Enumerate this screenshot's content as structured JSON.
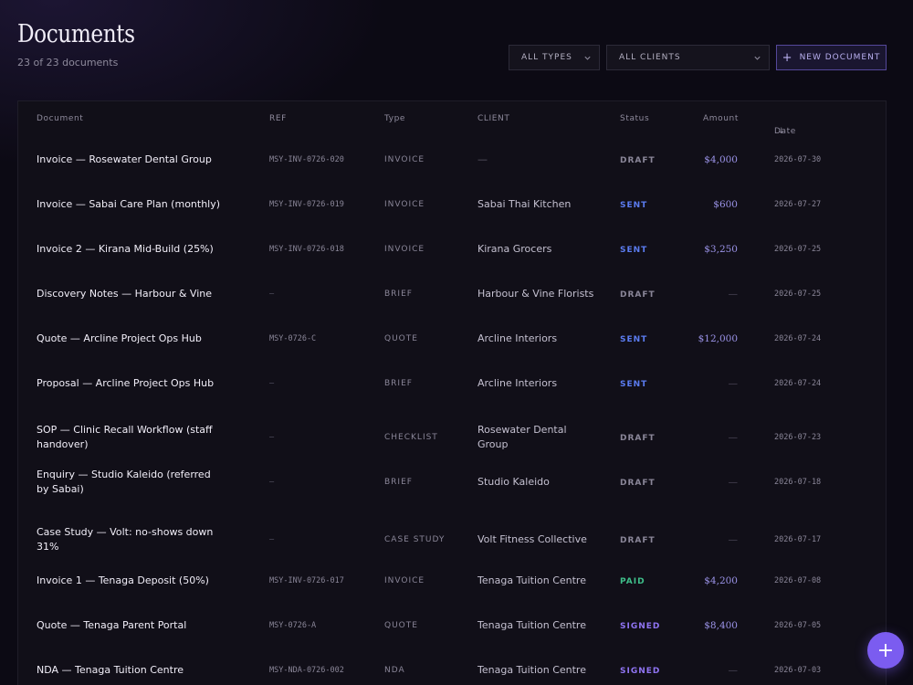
{
  "header": {
    "title": "Documents",
    "subtitle": "23 of 23 documents"
  },
  "toolbar": {
    "types_select": "ALL TYPES",
    "clients_select": "ALL CLIENTS",
    "new_document_label": "NEW DOCUMENT"
  },
  "columns": {
    "document": "Document",
    "ref": "REF",
    "type": "Type",
    "client": "CLIENT",
    "status": "Status",
    "amount": "Amount",
    "date": "Date",
    "date_sort": "↓"
  },
  "status_colors": {
    "DRAFT": "#8a8698",
    "SENT": "#5b7cf0",
    "PAID": "#3fbf8a",
    "SIGNED": "#8f74f2"
  },
  "rows": [
    {
      "name": "Invoice — Rosewater Dental Group",
      "ref": "MSY-INV-0726-020",
      "type": "INVOICE",
      "client": "—",
      "status": "DRAFT",
      "amount": "$4,000",
      "date": "2026-07-30"
    },
    {
      "name": "Invoice — Sabai Care Plan (monthly)",
      "ref": "MSY-INV-0726-019",
      "type": "INVOICE",
      "client": "Sabai Thai Kitchen",
      "status": "SENT",
      "amount": "$600",
      "date": "2026-07-27"
    },
    {
      "name": "Invoice 2 — Kirana Mid-Build (25%)",
      "ref": "MSY-INV-0726-018",
      "type": "INVOICE",
      "client": "Kirana Grocers",
      "status": "SENT",
      "amount": "$3,250",
      "date": "2026-07-25"
    },
    {
      "name": "Discovery Notes — Harbour & Vine",
      "ref": "—",
      "type": "BRIEF",
      "client": "Harbour & Vine Florists",
      "status": "DRAFT",
      "amount": "—",
      "date": "2026-07-25"
    },
    {
      "name": "Quote — Arcline Project Ops Hub",
      "ref": "MSY-0726-C",
      "type": "QUOTE",
      "client": "Arcline Interiors",
      "status": "SENT",
      "amount": "$12,000",
      "date": "2026-07-24"
    },
    {
      "name": "Proposal — Arcline Project Ops Hub",
      "ref": "—",
      "type": "BRIEF",
      "client": "Arcline Interiors",
      "status": "SENT",
      "amount": "—",
      "date": "2026-07-24"
    },
    {
      "name": "SOP — Clinic Recall Workflow (staff handover)",
      "ref": "—",
      "type": "CHECKLIST",
      "client": "Rosewater Dental Group",
      "status": "DRAFT",
      "amount": "—",
      "date": "2026-07-23"
    },
    {
      "name": "Enquiry — Studio Kaleido (referred by Sabai)",
      "ref": "—",
      "type": "BRIEF",
      "client": "Studio Kaleido",
      "status": "DRAFT",
      "amount": "—",
      "date": "2026-07-18"
    },
    {
      "name": "Case Study — Volt: no-shows down 31%",
      "ref": "—",
      "type": "CASE STUDY",
      "client": "Volt Fitness Collective",
      "status": "DRAFT",
      "amount": "—",
      "date": "2026-07-17"
    },
    {
      "name": "Invoice 1 — Tenaga Deposit (50%)",
      "ref": "MSY-INV-0726-017",
      "type": "INVOICE",
      "client": "Tenaga Tuition Centre",
      "status": "PAID",
      "amount": "$4,200",
      "date": "2026-07-08"
    },
    {
      "name": "Quote — Tenaga Parent Portal",
      "ref": "MSY-0726-A",
      "type": "QUOTE",
      "client": "Tenaga Tuition Centre",
      "status": "SIGNED",
      "amount": "$8,400",
      "date": "2026-07-05"
    },
    {
      "name": "NDA — Tenaga Tuition Centre",
      "ref": "MSY-NDA-0726-002",
      "type": "NDA",
      "client": "Tenaga Tuition Centre",
      "status": "SIGNED",
      "amount": "—",
      "date": "2026-07-03"
    }
  ],
  "fab": {
    "label": "+"
  }
}
